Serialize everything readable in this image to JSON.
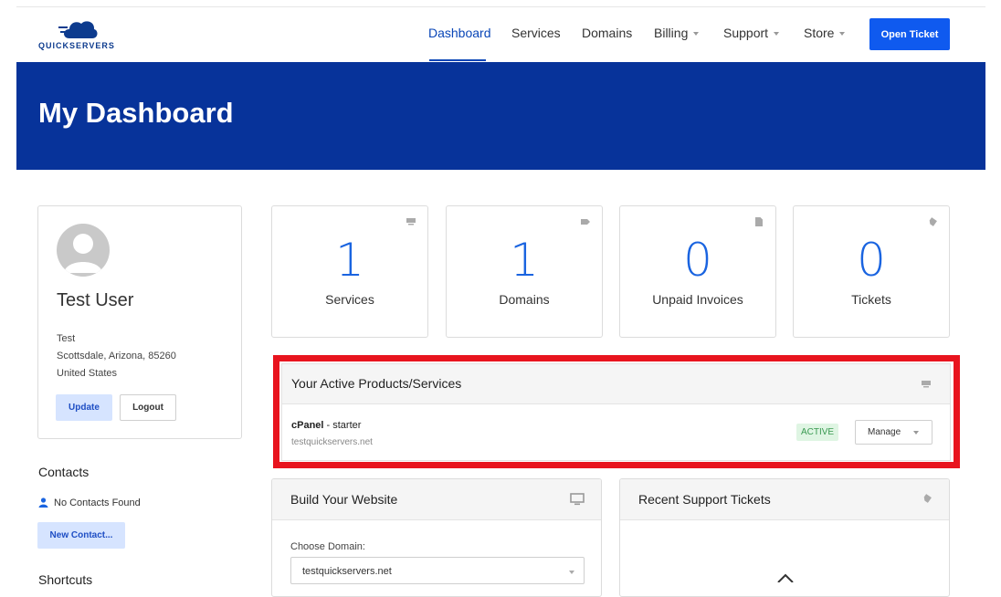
{
  "brand": {
    "name": "QUICKSERVERS",
    "primary_color": "#07339a",
    "accent_color": "#0f5aef"
  },
  "nav": {
    "items": [
      {
        "label": "Dashboard",
        "active": true
      },
      {
        "label": "Services"
      },
      {
        "label": "Domains"
      },
      {
        "label": "Billing",
        "dropdown": true
      },
      {
        "label": "Support",
        "dropdown": true
      },
      {
        "label": "Store",
        "dropdown": true
      }
    ],
    "cta": "Open Ticket"
  },
  "hero": {
    "title": "My Dashboard"
  },
  "profile": {
    "name": "Test User",
    "address_line1": "Test",
    "address_line2": "Scottsdale, Arizona, 85260",
    "address_line3": "United States",
    "update_label": "Update",
    "logout_label": "Logout"
  },
  "contacts": {
    "title": "Contacts",
    "empty_text": "No Contacts Found",
    "new_label": "New Contact..."
  },
  "shortcuts": {
    "title": "Shortcuts"
  },
  "stats": [
    {
      "value": "1",
      "label": "Services",
      "icon": "server-icon"
    },
    {
      "value": "1",
      "label": "Domains",
      "icon": "tag-icon"
    },
    {
      "value": "0",
      "label": "Unpaid Invoices",
      "icon": "document-icon"
    },
    {
      "value": "0",
      "label": "Tickets",
      "icon": "ticket-icon"
    }
  ],
  "products": {
    "title": "Your Active Products/Services",
    "item": {
      "product": "cPanel",
      "plan": " - starter",
      "domain": "testquickservers.net",
      "status": "ACTIVE",
      "manage_label": "Manage"
    }
  },
  "build": {
    "title": "Build Your Website",
    "choose_label": "Choose Domain:",
    "selected_domain": "testquickservers.net"
  },
  "tickets": {
    "title": "Recent Support Tickets"
  }
}
